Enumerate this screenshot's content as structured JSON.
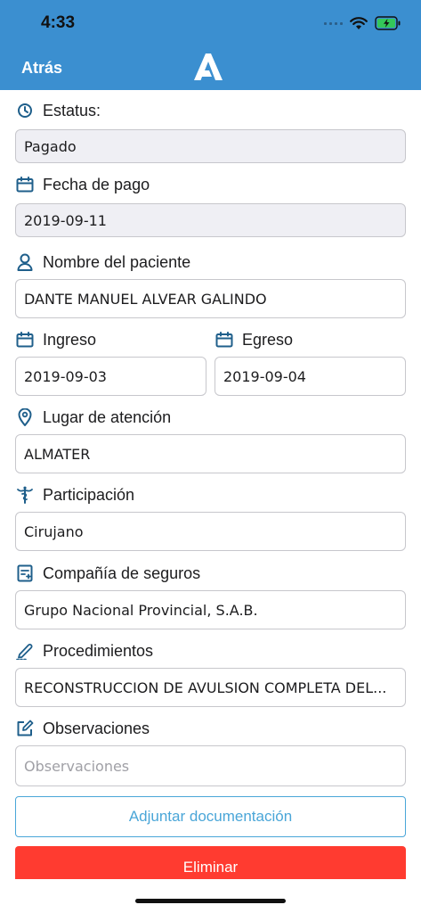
{
  "status_bar": {
    "time": "4:33"
  },
  "nav": {
    "back_label": "Atrás"
  },
  "form": {
    "estatus": {
      "label": "Estatus:",
      "value": "Pagado"
    },
    "fecha_pago": {
      "label": "Fecha de pago",
      "value": "2019-09-11"
    },
    "paciente": {
      "label": "Nombre del paciente",
      "value": "DANTE MANUEL ALVEAR GALINDO"
    },
    "ingreso": {
      "label": "Ingreso",
      "value": "2019-09-03"
    },
    "egreso": {
      "label": "Egreso",
      "value": "2019-09-04"
    },
    "lugar": {
      "label": "Lugar de atención",
      "value": "ALMATER"
    },
    "participacion": {
      "label": "Participación",
      "value": "Cirujano"
    },
    "compania": {
      "label": "Compañía de seguros",
      "value": "Grupo Nacional Provincial, S.A.B."
    },
    "procedimientos": {
      "label": "Procedimientos",
      "value": "RECONSTRUCCION DE AVULSION COMPLETA DEL..."
    },
    "observaciones": {
      "label": "Observaciones",
      "placeholder": "Observaciones"
    }
  },
  "actions": {
    "attach_label": "Adjuntar documentación",
    "delete_label": "Eliminar"
  },
  "colors": {
    "header": "#3b8fd0",
    "icon": "#1f5f8b",
    "accent": "#4aa6d8",
    "danger": "#ff3b30",
    "readonly_bg": "#efeff4"
  }
}
